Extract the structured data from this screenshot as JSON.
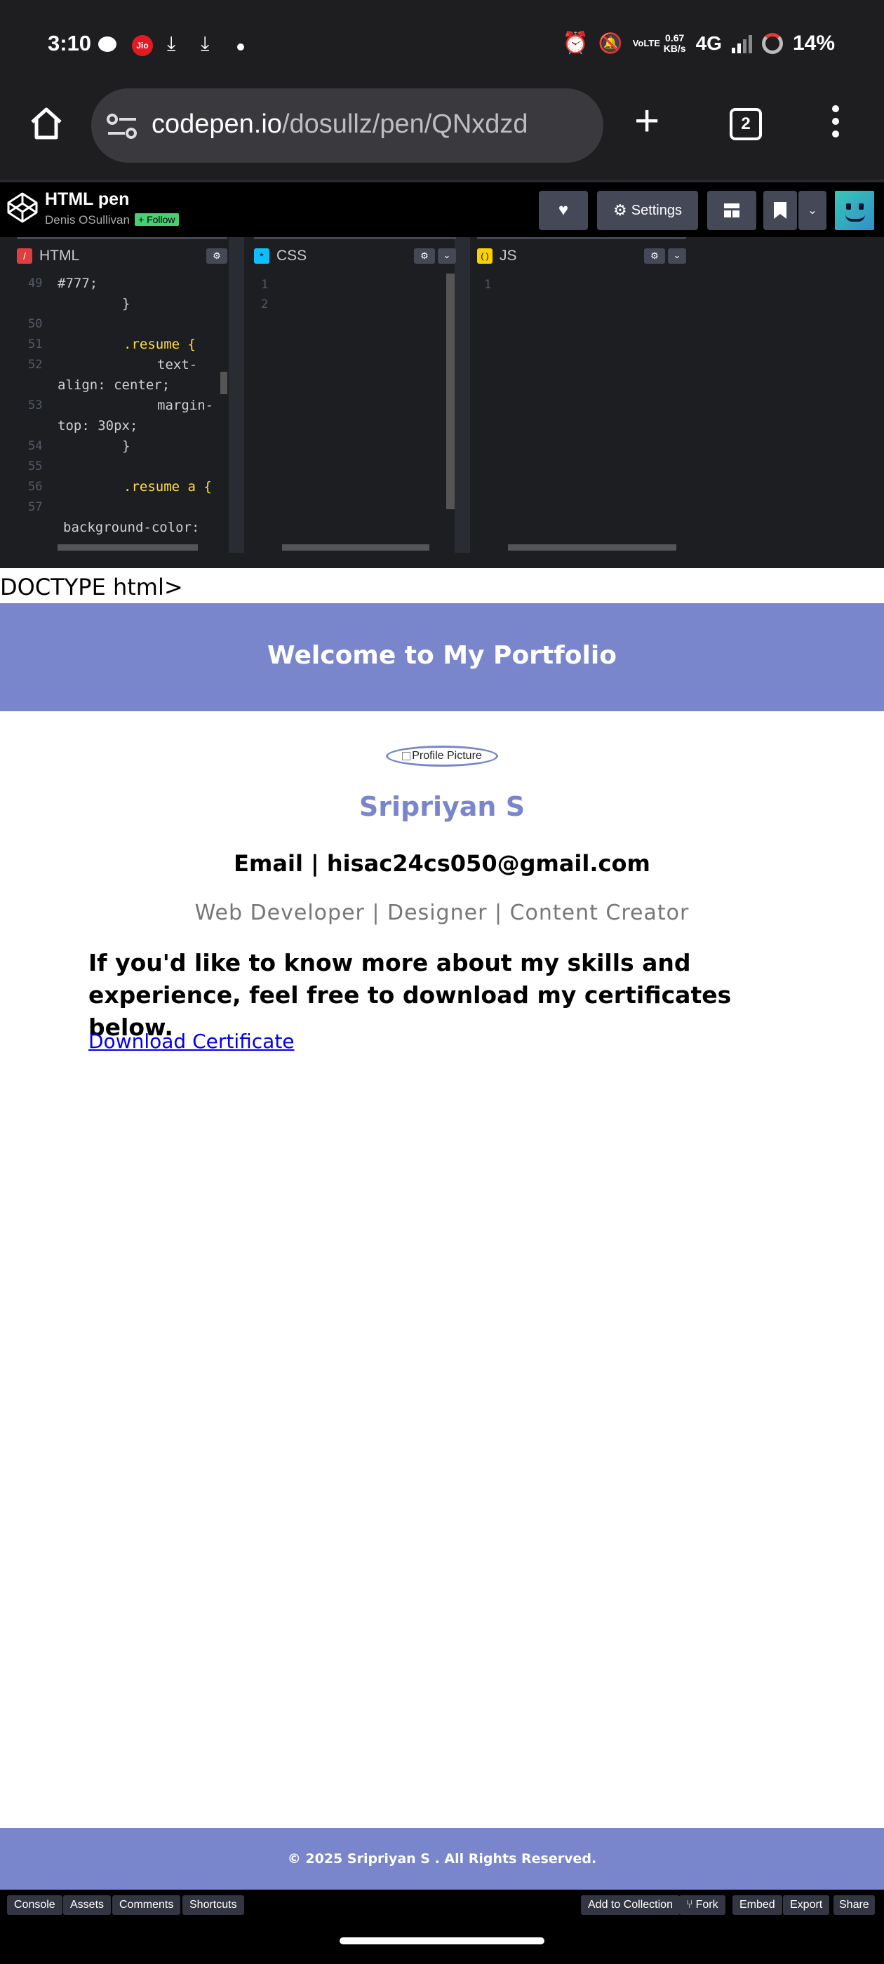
{
  "status_bar": {
    "time": "3:10",
    "carrier_badge": "Jio",
    "volte": "VoLTE",
    "speed_value": "0.67",
    "speed_unit": "KB/s",
    "network": "4G",
    "battery": "14%"
  },
  "browser": {
    "url_host": "codepen.io",
    "url_path": "/dosullz/pen/QNxdzd",
    "tab_count": "2"
  },
  "codepen": {
    "pen_title": "HTML pen",
    "author": "Denis OSullivan",
    "follow_label": "+ Follow",
    "settings_label": "Settings",
    "colors": {
      "follow_bg": "#47cf73",
      "header_bg": "#000000",
      "button_bg": "#444857"
    }
  },
  "editors": {
    "html": {
      "tab_label": "HTML",
      "lines": [
        {
          "num": "49",
          "text": "#777;"
        },
        {
          "num": "",
          "text": "}"
        },
        {
          "num": "50",
          "text": ""
        },
        {
          "num": "51",
          "text": ".resume {"
        },
        {
          "num": "52",
          "text": "text-"
        },
        {
          "num": "",
          "text": "align: center;"
        },
        {
          "num": "53",
          "text": "margin-"
        },
        {
          "num": "",
          "text": "top: 30px;"
        },
        {
          "num": "54",
          "text": "}"
        },
        {
          "num": "55",
          "text": ""
        },
        {
          "num": "56",
          "text": ".resume a {"
        },
        {
          "num": "57",
          "text": ""
        },
        {
          "num": "",
          "text": "background-color:"
        }
      ]
    },
    "css": {
      "tab_label": "CSS",
      "line_numbers": [
        "1",
        "2"
      ]
    },
    "js": {
      "tab_label": "JS",
      "line_numbers": [
        "1"
      ]
    }
  },
  "preview": {
    "doctype_text": "DOCTYPE html>",
    "banner_title": "Welcome to My Portfolio",
    "profile_alt": "Profile Picture",
    "name": "Sripriyan S",
    "email": "Email | hisac24cs050@gmail.com",
    "roles": "Web Developer | Designer | Content Creator",
    "intro": "If you'd like to know more about my skills and experience, feel free to download my certificates below.",
    "download_link": "Download Certificate",
    "footer": "© 2025 Sripriyan S . All Rights Reserved.",
    "colors": {
      "accent": "#7986cb",
      "link": "#0000ee"
    }
  },
  "bottom_bar": {
    "left": [
      "Console",
      "Assets",
      "Comments",
      "Shortcuts"
    ],
    "right": [
      "Add to Collection",
      "Fork",
      "Embed",
      "Export",
      "Share"
    ]
  }
}
